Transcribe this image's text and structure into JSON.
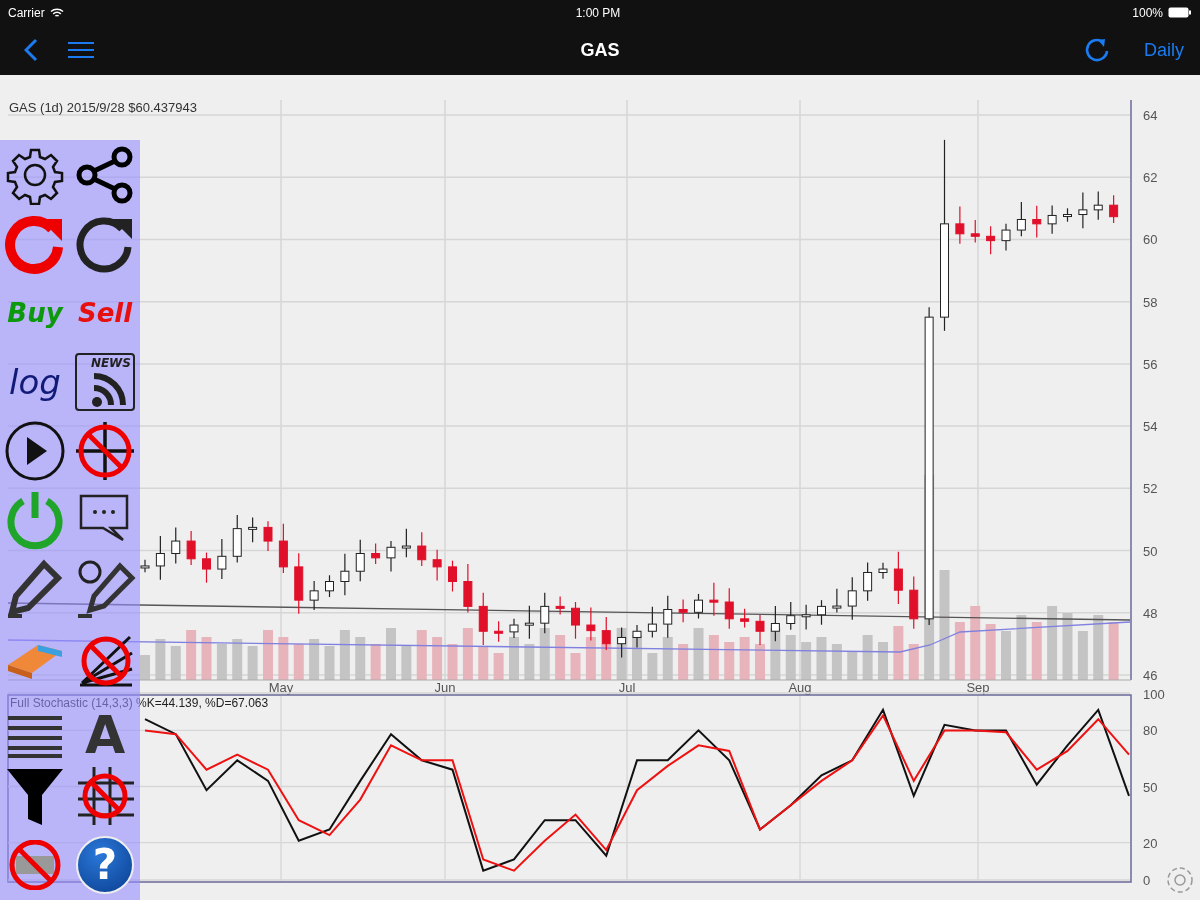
{
  "status_bar": {
    "carrier": "Carrier",
    "time": "1:00 PM",
    "battery": "100%"
  },
  "nav_bar": {
    "title": "GAS",
    "period": "Daily"
  },
  "toolbar": {
    "buy_label": "Buy",
    "sell_label": "Sell",
    "log_label": "log",
    "news_label": "NEWS",
    "text_tool_label": "A",
    "help_label": "?"
  },
  "price_chart": {
    "header": "GAS (1d) 2015/9/28 $60.437943",
    "y_axis_labels": [
      "64",
      "62",
      "60",
      "58",
      "56",
      "54",
      "52",
      "50",
      "48",
      "46"
    ],
    "x_axis_labels": [
      "May",
      "Jun",
      "Jul",
      "Aug",
      "Sep"
    ]
  },
  "stochastic_chart": {
    "header": "Full Stochastic (14,3,3) %K=44.139, %D=67.063",
    "y_axis_labels": [
      "100",
      "80",
      "50",
      "20",
      "0"
    ]
  }
}
